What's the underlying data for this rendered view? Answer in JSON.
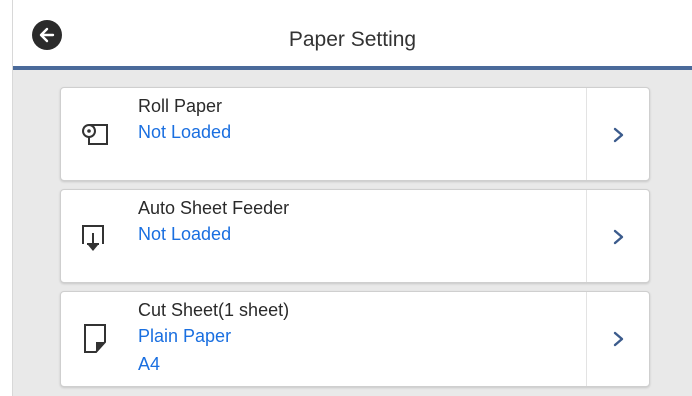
{
  "header": {
    "title": "Paper Setting",
    "back_icon": "back-arrow-icon"
  },
  "items": [
    {
      "name": "Roll Paper",
      "status": "Not Loaded",
      "icon": "roll-paper-icon"
    },
    {
      "name": "Auto Sheet Feeder",
      "status": "Not Loaded",
      "icon": "sheet-feeder-icon"
    },
    {
      "name": "Cut Sheet(1 sheet)",
      "status": "Plain Paper",
      "size": "A4",
      "icon": "cut-sheet-icon"
    }
  ],
  "colors": {
    "accent_text": "#1a6fe0",
    "header_rule": "#4a6a9a",
    "back_button": "#2b2b2b"
  }
}
